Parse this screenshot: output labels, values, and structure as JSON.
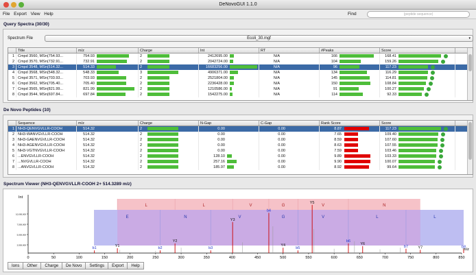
{
  "window": {
    "title": "DeNovoGUI 1.1.0"
  },
  "menu": [
    "File",
    "Export",
    "View",
    "Help"
  ],
  "find": {
    "label": "Find",
    "placeholder": "(peptide sequence)"
  },
  "query": {
    "header": "Query Spectra (30/30)",
    "file_label": "Spectrum File",
    "file_value": "Ecoli_30.mgf",
    "columns": [
      "",
      "Title",
      "m/z",
      "Charge",
      "Int",
      "RT",
      "#Peaks",
      "Score"
    ],
    "rows": [
      [
        "1",
        "Cmpd 3560, MSn(754.93...",
        "754.93",
        "2",
        "2412695.00",
        "N/A",
        "166",
        "168.41"
      ],
      [
        "2",
        "Cmpd 3570, MSn(732.91...",
        "732.91",
        "2",
        "2042724.00",
        "N/A",
        "104",
        "159.26"
      ],
      [
        "3",
        "Cmpd 3548, MSn(514.32...",
        "514.33",
        "2",
        "16683256.00",
        "N/A",
        "96",
        "117.23"
      ],
      [
        "4",
        "Cmpd 3568, MSn(548.32...",
        "548.33",
        "3",
        "4906371.00",
        "N/A",
        "134",
        "116.29"
      ],
      [
        "5",
        "Cmpd 3571, MSn(703.93...",
        "703.93",
        "2",
        "2521804.00",
        "N/A",
        "145",
        "114.81"
      ],
      [
        "6",
        "Cmpd 3562, MSn(705.40...",
        "705.40",
        "2",
        "2236428.00",
        "N/A",
        "150",
        "108.84"
      ],
      [
        "7",
        "Cmpd 3565, MSn(821.99...",
        "821.99",
        "2",
        "1210586.00",
        "N/A",
        "91",
        "100.27"
      ],
      [
        "8",
        "Cmpd 3544, MSn(697.84...",
        "697.84",
        "2",
        "1542275.00",
        "N/A",
        "114",
        "92.33"
      ]
    ],
    "mz_frac": [
      0.85,
      0.8,
      0.5,
      0.58,
      0.78,
      0.78,
      1.0,
      0.76
    ],
    "ch_frac": [
      0.7,
      0.7,
      0.7,
      1.0,
      0.7,
      0.7,
      0.7,
      0.7
    ],
    "int_frac": [
      0.16,
      0.13,
      1.0,
      0.31,
      0.16,
      0.14,
      0.08,
      0.1
    ],
    "pk_frac": [
      1.0,
      0.62,
      0.58,
      0.8,
      0.87,
      0.9,
      0.55,
      0.68
    ],
    "sc_frac": [
      1.0,
      0.94,
      0.7,
      0.69,
      0.68,
      0.64,
      0.6,
      0.55
    ],
    "selected": 2
  },
  "peptides": {
    "header": "De Novo Peptides (10)",
    "columns": [
      "",
      "Sequence",
      "m/z",
      "Charge",
      "N-Gap",
      "C-Gap",
      "Rank Score",
      "Score"
    ],
    "rows": [
      [
        "1",
        "NH3-QENVGVLLR-COOH",
        "514.32",
        "2",
        "0.00",
        "0.00",
        "8.87",
        "117.23"
      ],
      [
        "2",
        "NH3-WANVGVLLR-COOH",
        "514.32",
        "2",
        "0.00",
        "0.00",
        "7.65",
        "109.40"
      ],
      [
        "3",
        "NH3-GAENVGVLLR-COOH",
        "514.32",
        "2",
        "0.00",
        "0.00",
        "8.59",
        "107.60"
      ],
      [
        "4",
        "NH3-AGENVGVLLR-COOH",
        "514.32",
        "2",
        "0.00",
        "0.00",
        "8.63",
        "107.55"
      ],
      [
        "5",
        "NH3-VGTNVGVLLR-COOH",
        "514.32",
        "2",
        "0.00",
        "0.00",
        "7.59",
        "103.46"
      ],
      [
        "6",
        "...ENVGVLLR-COOH",
        "514.32",
        "2",
        "128.10",
        "0.00",
        "9.89",
        "103.33"
      ],
      [
        "7",
        "...NVGVLLR-COOH",
        "514.32",
        "2",
        "257.16",
        "0.00",
        "9.90",
        "100.07"
      ],
      [
        "8",
        "...ANVGVLLR-COOH",
        "514.32",
        "2",
        "185.97",
        "0.00",
        "8.92",
        "99.64"
      ]
    ],
    "gap_frac": [
      0,
      0,
      0,
      0,
      0,
      0.5,
      1.0,
      0.72
    ],
    "rank_frac": [
      0.9,
      0,
      0,
      0,
      0,
      1.0,
      1.0,
      0.9
    ],
    "sc_frac": [
      1.0,
      0.93,
      0.92,
      0.92,
      0.88,
      0.88,
      0.85,
      0.85
    ],
    "selected": 0
  },
  "viewer": {
    "header": "Spectrum Viewer (NH3-QENVGVLLR-COOH   2+   514.3289 m/z)",
    "ylabel": "Int",
    "xlabel": "m/z",
    "xticks": [
      "0",
      "50",
      "100",
      "150",
      "200",
      "250",
      "300",
      "350",
      "400",
      "450",
      "500",
      "550",
      "600",
      "650",
      "700",
      "750",
      "800",
      "850"
    ],
    "yticks": [
      "10,000,000",
      "7,500,000",
      "5,000,000",
      "2,500,000"
    ],
    "y_letters": [
      "L",
      "L",
      "V",
      "G",
      "V",
      "N"
    ],
    "b_letters": [
      "E",
      "N",
      "V",
      "G",
      "V",
      "L",
      "L"
    ],
    "ions": [
      {
        "label": "b1",
        "mz": 130,
        "h": 0.05,
        "c": "#2233cc"
      },
      {
        "label": "Y1",
        "mz": 175,
        "h": 0.09,
        "c": "#111"
      },
      {
        "label": "b2",
        "mz": 259,
        "h": 0.05,
        "c": "#2233cc"
      },
      {
        "label": "Y2",
        "mz": 288,
        "h": 0.18,
        "c": "#111"
      },
      {
        "label": "b3",
        "mz": 358,
        "h": 0.05,
        "c": "#2233cc"
      },
      {
        "label": "Y3",
        "mz": 401,
        "h": 0.58,
        "c": "#111"
      },
      {
        "label": "b4",
        "mz": 472,
        "h": 0.75,
        "c": "#2233cc"
      },
      {
        "label": "Y4",
        "mz": 500,
        "h": 0.1,
        "c": "#111"
      },
      {
        "label": "b5",
        "mz": 529,
        "h": 0.05,
        "c": "#2233cc"
      },
      {
        "label": "Y5",
        "mz": 557,
        "h": 0.9,
        "c": "#111"
      },
      {
        "label": "b6",
        "mz": 628,
        "h": 0.18,
        "c": "#2233cc"
      },
      {
        "label": "Y6",
        "mz": 656,
        "h": 0.13,
        "c": "#111"
      },
      {
        "label": "b7",
        "mz": 741,
        "h": 0.08,
        "c": "#2233cc"
      },
      {
        "label": "Y7",
        "mz": 769,
        "h": 0.06,
        "c": "#111"
      },
      {
        "label": "b8",
        "mz": 854,
        "h": 0.07,
        "c": "#2233cc"
      }
    ],
    "tabs": [
      "Ions",
      "Other",
      "Charge",
      "De Novo",
      "Settings",
      "Export",
      "Help"
    ]
  }
}
